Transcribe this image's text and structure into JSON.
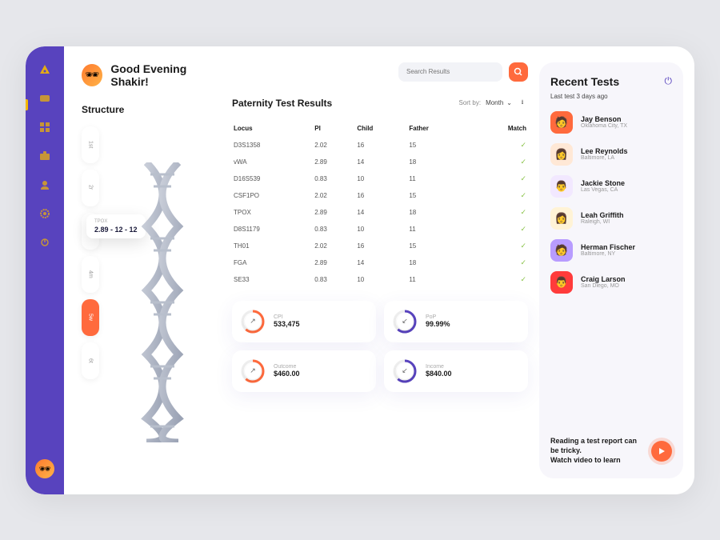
{
  "greeting": "Good Evening Shakir!",
  "search": {
    "placeholder": "Search Results"
  },
  "structure": {
    "title": "Structure",
    "tabs": [
      "1st",
      "2r",
      "3m",
      "4m",
      "5w",
      "6t"
    ],
    "active_index": 4,
    "tooltip": {
      "label": "TPOX",
      "value": "2.89 - 12 - 12"
    }
  },
  "results": {
    "title": "Paternity Test Results",
    "sort_label": "Sort by:",
    "sort_value": "Month",
    "columns": [
      "Locus",
      "PI",
      "Child",
      "Father",
      "Match"
    ],
    "rows": [
      {
        "locus": "D3S1358",
        "pi": "2.02",
        "child": "16",
        "father": "15",
        "match": true
      },
      {
        "locus": "vWA",
        "pi": "2.89",
        "child": "14",
        "father": "18",
        "match": true
      },
      {
        "locus": "D16S539",
        "pi": "0.83",
        "child": "10",
        "father": "11",
        "match": true
      },
      {
        "locus": "CSF1PO",
        "pi": "2.02",
        "child": "16",
        "father": "15",
        "match": true
      },
      {
        "locus": "TPOX",
        "pi": "2.89",
        "child": "14",
        "father": "18",
        "match": true
      },
      {
        "locus": "D8S1179",
        "pi": "0.83",
        "child": "10",
        "father": "11",
        "match": true
      },
      {
        "locus": "TH01",
        "pi": "2.02",
        "child": "16",
        "father": "15",
        "match": true
      },
      {
        "locus": "FGA",
        "pi": "2.89",
        "child": "14",
        "father": "18",
        "match": true
      },
      {
        "locus": "SE33",
        "pi": "0.83",
        "child": "10",
        "father": "11",
        "match": true
      }
    ]
  },
  "metrics": [
    {
      "label": "CPI",
      "value": "533,475",
      "ring": "#ff6a3d",
      "arrow": "↗"
    },
    {
      "label": "PoP",
      "value": "99.99%",
      "ring": "#5843be",
      "arrow": "↙"
    },
    {
      "label": "Outcome",
      "value": "$460.00",
      "ring": "#ff6a3d",
      "arrow": "↗"
    },
    {
      "label": "Income",
      "value": "$840.00",
      "ring": "#5843be",
      "arrow": "↙"
    }
  ],
  "recent": {
    "title": "Recent Tests",
    "subtitle": "Last test 3 days ago",
    "items": [
      {
        "name": "Jay Benson",
        "loc": "Oklahoma City, TX",
        "bg": "#ff6a3d",
        "emoji": "🧑"
      },
      {
        "name": "Lee Reynolds",
        "loc": "Baltimore, LA",
        "bg": "#ffe8d6",
        "emoji": "👩"
      },
      {
        "name": "Jackie Stone",
        "loc": "Las Vegas, CA",
        "bg": "#f2e8ff",
        "emoji": "👨"
      },
      {
        "name": "Leah Griffith",
        "loc": "Raleigh, WI",
        "bg": "#fff3d6",
        "emoji": "👩"
      },
      {
        "name": "Herman Fischer",
        "loc": "Baltimore, NY",
        "bg": "#b89cff",
        "emoji": "🧑"
      },
      {
        "name": "Craig Larson",
        "loc": "San Diego, MO",
        "bg": "#ff3b3b",
        "emoji": "👨"
      }
    ],
    "video_text": "Reading a test report can be tricky.\nWatch video to learn"
  }
}
